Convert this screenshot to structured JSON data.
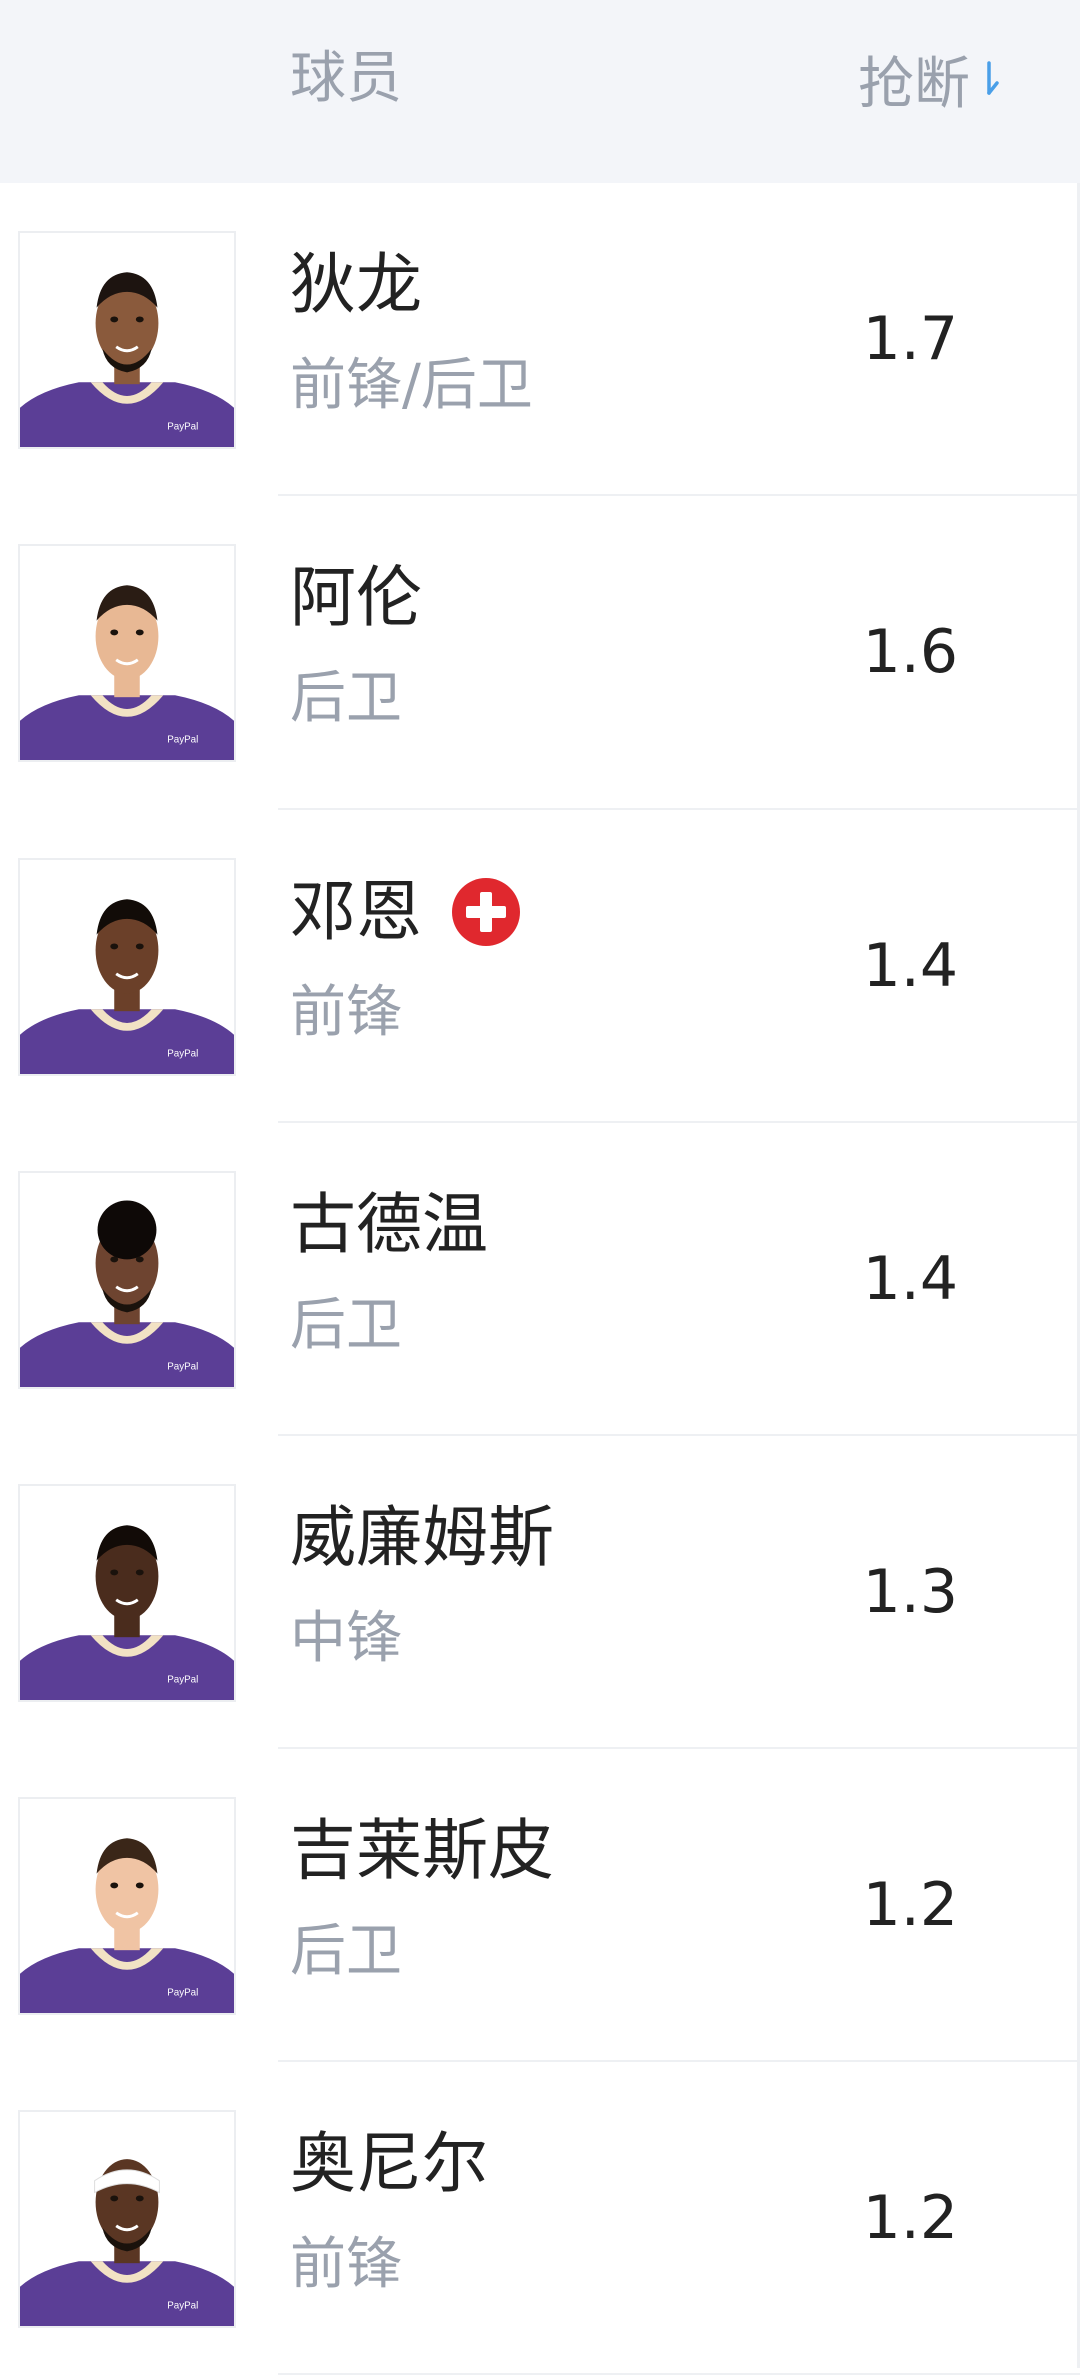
{
  "header": {
    "player_col_label": "球员",
    "stat_col_label": "抢断",
    "sort_icon": "sort-descending-arrow-icon",
    "accent_color": "#4a9fe8"
  },
  "rows": [
    {
      "name": "狄龙",
      "position": "前锋/后卫",
      "value": "1.7",
      "injured": false,
      "avatar_icon": "player-headshot"
    },
    {
      "name": "阿伦",
      "position": "后卫",
      "value": "1.6",
      "injured": false,
      "avatar_icon": "player-headshot"
    },
    {
      "name": "邓恩",
      "position": "前锋",
      "value": "1.4",
      "injured": true,
      "avatar_icon": "player-headshot"
    },
    {
      "name": "古德温",
      "position": "后卫",
      "value": "1.4",
      "injured": false,
      "avatar_icon": "player-headshot"
    },
    {
      "name": "威廉姆斯",
      "position": "中锋",
      "value": "1.3",
      "injured": false,
      "avatar_icon": "player-headshot"
    },
    {
      "name": "吉莱斯皮",
      "position": "后卫",
      "value": "1.2",
      "injured": false,
      "avatar_icon": "player-headshot"
    },
    {
      "name": "奥尼尔",
      "position": "前锋",
      "value": "1.2",
      "injured": false,
      "avatar_icon": "player-headshot"
    }
  ],
  "colors": {
    "jersey": "#5b3e96",
    "injury_badge": "#e0282e",
    "secondary_text": "#9aa1ad"
  }
}
